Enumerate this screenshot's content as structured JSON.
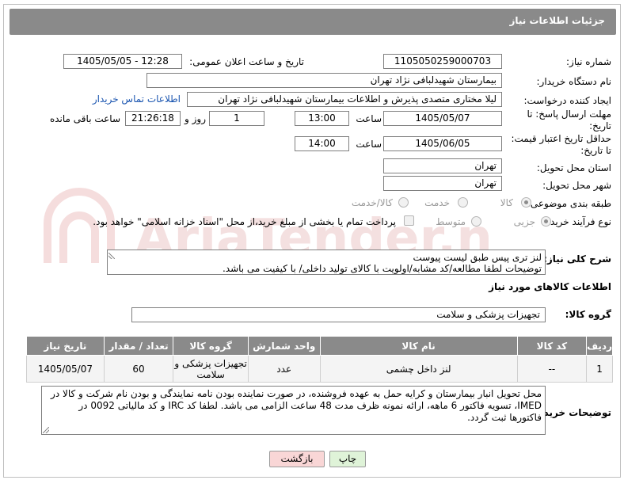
{
  "header": {
    "title": "جزئیات اطلاعات نیاز"
  },
  "fields": {
    "need_number": {
      "label": "شماره نیاز:",
      "value": "1105050259000703"
    },
    "announce_datetime": {
      "label": "تاریخ و ساعت اعلان عمومی:",
      "value": "1405/05/05 - 12:28"
    },
    "buyer_org": {
      "label": "نام دستگاه خریدار:",
      "value": "بیمارستان شهیدلبافی نژاد تهران"
    },
    "requester": {
      "label": "ایجاد کننده درخواست:",
      "value": "لیلا مختاری متصدی پذیرش و اطلاعات بیمارستان شهیدلبافی نژاد تهران",
      "contact_link": "اطلاعات تماس خریدار"
    },
    "reply_deadline": {
      "label_line1": "مهلت ارسال پاسخ: تا",
      "label_line2": "تاریخ:",
      "date": "1405/05/07",
      "time_label": "ساعت",
      "time": "13:00",
      "days": "1",
      "days_label": "روز و",
      "remaining": "21:26:18",
      "remaining_label": "ساعت باقی مانده"
    },
    "price_validity": {
      "label_line1": "حداقل تاریخ اعتبار قیمت:",
      "label_line2": "تا تاریخ:",
      "date": "1405/06/05",
      "time_label": "ساعت",
      "time": "14:00"
    },
    "delivery_province": {
      "label": "استان محل تحویل:",
      "value": "تهران"
    },
    "delivery_city": {
      "label": "شهر محل تحویل:",
      "value": "تهران"
    },
    "category": {
      "label": "طبقه بندی موضوعی:",
      "options": [
        "کالا",
        "خدمت",
        "کالا/خدمت"
      ]
    },
    "process_type": {
      "label": "نوع فرآیند خرید :",
      "options": [
        "جزیی",
        "متوسط"
      ],
      "payment_note": "پرداخت تمام یا بخشی از مبلغ خرید،از محل \"اسناد خزانه اسلامی\" خواهد بود."
    }
  },
  "description": {
    "label": "شرح کلی نیاز:",
    "line1": "لنز تری پیس طبق لیست پیوست",
    "line2": "توضیحات لطفا مطالعه/کد مشابه/اولویت با کالای تولید داخلی/ با کیفیت می باشد."
  },
  "goods_info": {
    "title": "اطلاعات کالاهای مورد نیاز",
    "group_label": "گروه کالا:",
    "group_value": "تجهیزات پزشکی و سلامت"
  },
  "table": {
    "headers": [
      "ردیف",
      "کد کالا",
      "نام کالا",
      "واحد شمارش",
      "گروه کالا",
      "تعداد / مقدار",
      "تاریخ نیاز"
    ],
    "rows": [
      [
        "1",
        "--",
        "لنز داخل چشمی",
        "عدد",
        "تجهیزات پزشکی و سلامت",
        "60",
        "1405/05/07"
      ]
    ]
  },
  "buyer_notes": {
    "label": "توضیحات خریدار:",
    "text": "محل تحویل انبار بیمارستان و کرایه حمل به عهده فروشنده، در صورت نماینده بودن نامه نمایندگی و بودن نام شرکت و کالا در IMED، تسویه فاکتور 6 ماهه، ارائه نمونه ظرف مدت 48 ساعت الزامی می باشد. لطفا کد IRC و کد مالیاتی 0092 در فاکتورها ثبت گردد."
  },
  "buttons": {
    "print": "چاپ",
    "back": "بازگشت"
  },
  "colors": {
    "header_bg": "#8a8a8a",
    "link": "#1a55b0",
    "back_btn_bg": "#f9d6d6",
    "print_btn_bg": "#dff3d8"
  }
}
